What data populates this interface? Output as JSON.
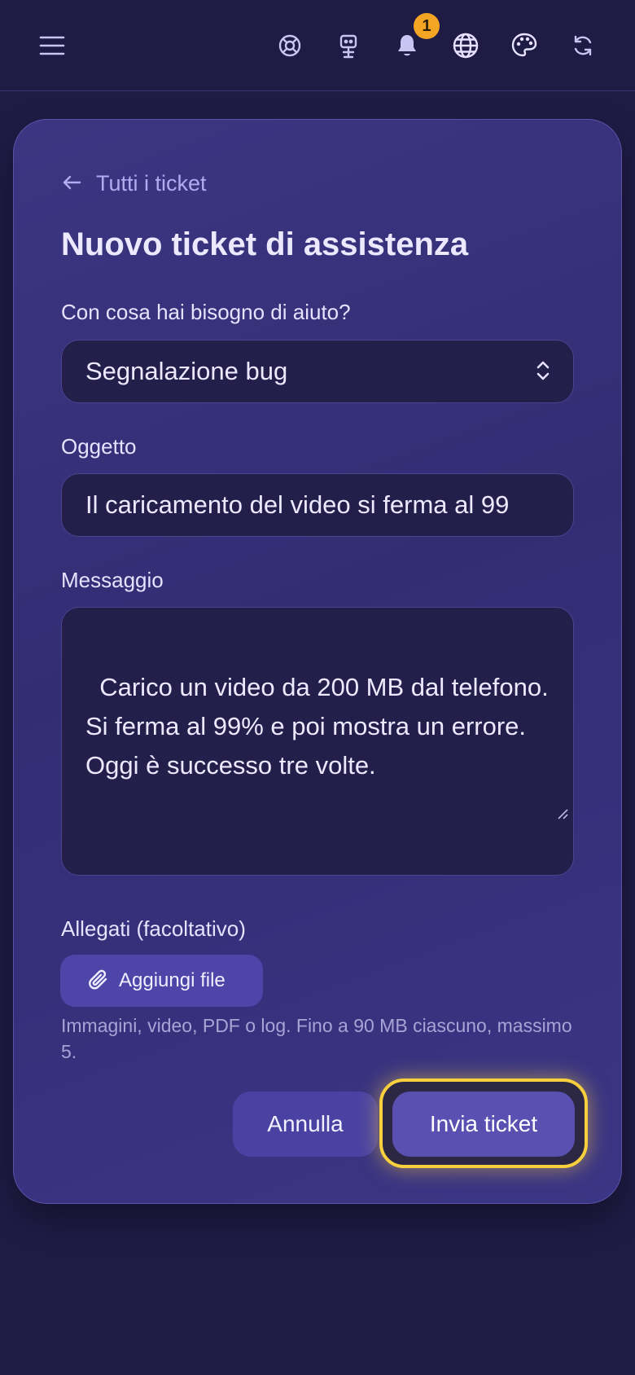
{
  "header": {
    "notification_count": "1",
    "icons": [
      "menu-icon",
      "help-icon",
      "robot-icon",
      "bell-icon",
      "globe-icon",
      "palette-icon",
      "refresh-icon"
    ]
  },
  "form": {
    "back_label": "Tutti i ticket",
    "title": "Nuovo ticket di assistenza",
    "category_label": "Con cosa hai bisogno di aiuto?",
    "category_value": "Segnalazione bug",
    "subject_label": "Oggetto",
    "subject_value": "Il caricamento del video si ferma al 99",
    "message_label": "Messaggio",
    "message_value": "Carico un video da 200 MB dal telefono. Si ferma al 99% e poi mostra un errore. Oggi è successo tre volte.",
    "attachments_label": "Allegati (facoltativo)",
    "add_file_label": "Aggiungi file",
    "attachments_hint": "Immagini, video, PDF o log. Fino a 90 MB ciascuno, massimo 5.",
    "cancel_label": "Annulla",
    "submit_label": "Invia ticket"
  },
  "colors": {
    "background": "#1f1b45",
    "card": "#3c3682",
    "accent": "#5a50b2",
    "highlight": "#f8cf3d",
    "badge": "#f5a524"
  }
}
